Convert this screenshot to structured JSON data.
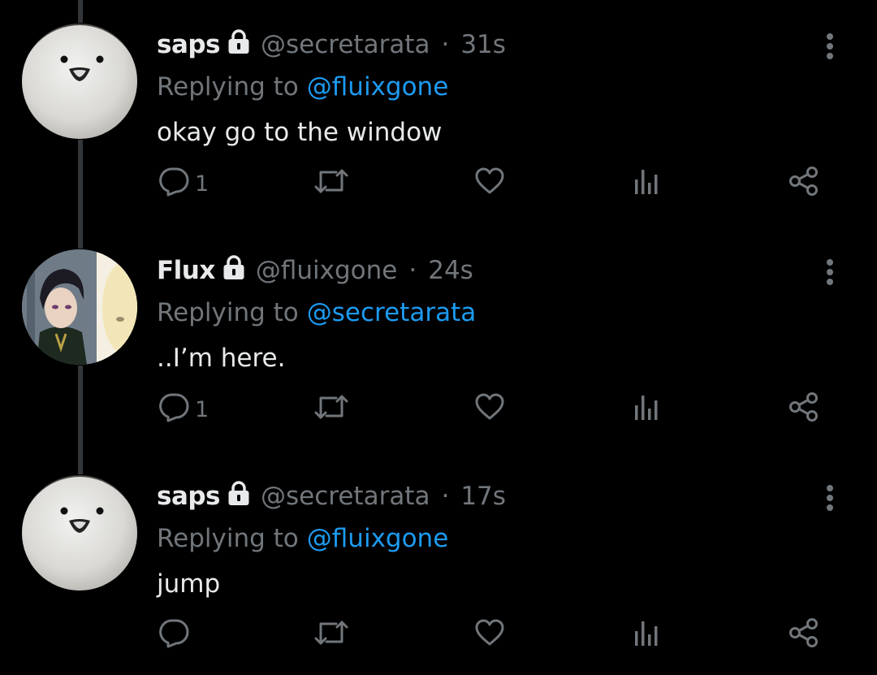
{
  "tweets": [
    {
      "display_name": "saps",
      "handle": "@secretarata",
      "separator": "·",
      "time": "31s",
      "reply_prefix": "Replying to",
      "reply_to": "@fluixgone",
      "text": "okay go to the window",
      "reply_count": "1",
      "avatar": "plush-avatar"
    },
    {
      "display_name": "Flux",
      "handle": "@fluixgone",
      "separator": "·",
      "time": "24s",
      "reply_prefix": "Replying to",
      "reply_to": "@secretarata",
      "text": "..I’m here.",
      "reply_count": "1",
      "avatar": "anime-avatar"
    },
    {
      "display_name": "saps",
      "handle": "@secretarata",
      "separator": "·",
      "time": "17s",
      "reply_prefix": "Replying to",
      "reply_to": "@fluixgone",
      "text": "jump",
      "reply_count": "",
      "avatar": "plush-avatar"
    }
  ],
  "icons": {
    "lock": "lock-icon",
    "more": "more-vertical-icon",
    "reply": "reply-icon",
    "retweet": "retweet-icon",
    "like": "heart-icon",
    "analytics": "analytics-icon",
    "share": "share-icon"
  },
  "colors": {
    "background": "#000000",
    "primary_text": "#e7e9ea",
    "secondary_text": "#71767b",
    "link": "#1d9bf0",
    "thread_line": "#333639"
  }
}
